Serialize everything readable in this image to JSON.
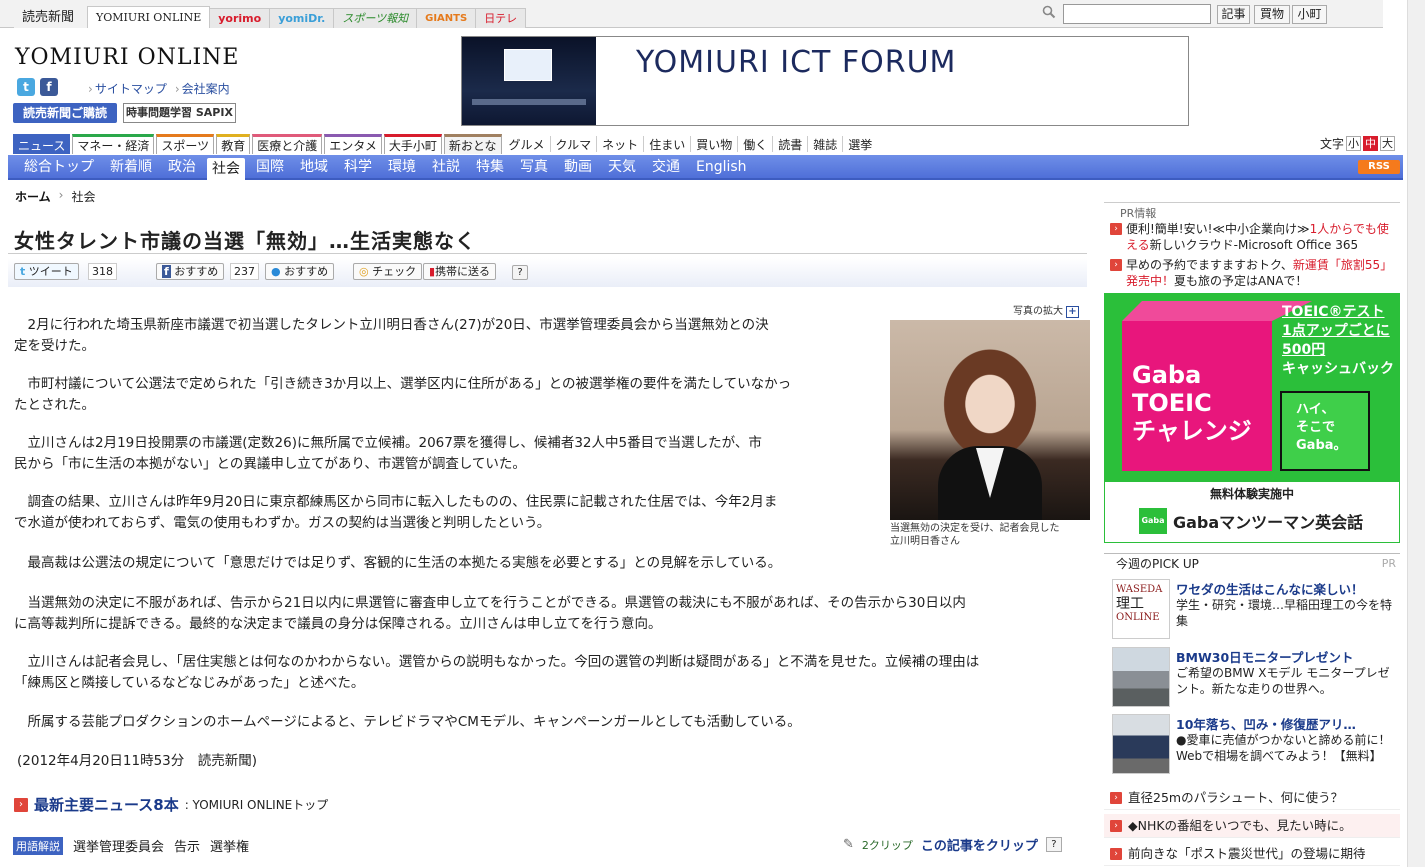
{
  "top_tabs": [
    "読売新聞",
    "YOMIURI ONLINE",
    "yorimo",
    "yomiDr.",
    "スポーツ報知",
    "GIANTS",
    "日テレ"
  ],
  "search": {
    "placeholder": "",
    "buttons": [
      "記事",
      "買物",
      "小町"
    ]
  },
  "header": {
    "logo": "YOMIURI ONLINE",
    "links": [
      "サイトマップ",
      "会社案内"
    ],
    "subscribe": "読売新聞ご購読",
    "sapix": "時事問題学習 SAPIX"
  },
  "banner": {
    "text": "YOMIURI ICT FORUM"
  },
  "category_tabs": [
    "ニュース",
    "マネー・経済",
    "スポーツ",
    "教育",
    "医療と介護",
    "エンタメ",
    "大手小町",
    "新おとな"
  ],
  "category_links": [
    "グルメ",
    "クルマ",
    "ネット",
    "住まい",
    "買い物",
    "働く",
    "読書",
    "雑誌",
    "選挙"
  ],
  "text_size": {
    "label": "文字",
    "options": [
      "小",
      "中",
      "大"
    ]
  },
  "nav": [
    "総合トップ",
    "新着順",
    "政治",
    "社会",
    "国際",
    "地域",
    "科学",
    "環境",
    "社説",
    "特集",
    "写真",
    "動画",
    "天気",
    "交通",
    "English"
  ],
  "nav_active": "社会",
  "rss": "RSS",
  "breadcrumb": {
    "home": "ホーム",
    "current": "社会"
  },
  "article": {
    "headline": "女性タレント市議の当選「無効」…生活実態なく",
    "share": {
      "tweet": "ツイート",
      "tweet_count": "318",
      "fb": "おすすめ",
      "fb_count": "237",
      "mixi": "おすすめ",
      "check": "チェック",
      "mobile": "携帯に送る",
      "help": "?"
    },
    "photo_zoom": "写真の拡大",
    "photo_caption_1": "当選無効の決定を受け、記者会見した",
    "photo_caption_2": "立川明日香さん",
    "paragraphs": [
      [
        "　2月に行われた埼玉県新座市議選で初当選したタレント立川明日香さん(27)が20日、市選挙管理委員会から当選無効との決",
        "定を受けた。"
      ],
      [
        "　市町村議について公選法で定められた「引き続き3か月以上、選挙区内に住所がある」との被選挙権の要件を満たしていなかっ",
        "たとされた。"
      ],
      [
        "　立川さんは2月19日投開票の市議選(定数26)に無所属で立候補。2067票を獲得し、候補者32人中5番目で当選したが、市",
        "民から「市に生活の本拠がない」との異議申し立てがあり、市選管が調査していた。"
      ],
      [
        "　調査の結果、立川さんは昨年9月20日に東京都練馬区から同市に転入したものの、住民票に記載された住居では、今年2月ま",
        "で水道が使われておらず、電気の使用もわずか。ガスの契約は当選後と判明したという。"
      ],
      [
        "　最高裁は公選法の規定について「意思だけでは足りず、客観的に生活の本拠たる実態を必要とする」との見解を示している。"
      ],
      [
        "　当選無効の決定に不服があれば、告示から21日以内に県選管に審査申し立てを行うことができる。県選管の裁決にも不服があれば、その告示から30日以内",
        "に高等裁判所に提訴できる。最終的な決定まで議員の身分は保障される。立川さんは申し立てを行う意向。"
      ],
      [
        "　立川さんは記者会見し、「居住実態とは何なのかわからない。選管からの説明もなかった。今回の選管の判断は疑問がある」と不満を見せた。立候補の理由は",
        "「練馬区と隣接しているなどなじみがあった」と述べた。"
      ],
      [
        "　所属する芸能プロダクションのホームページによると、テレビドラマやCMモデル、キャンペーンガールとしても活動している。"
      ]
    ],
    "date": "(2012年4月20日11時53分　読売新聞)",
    "more_news": "最新主要ニュース8本",
    "more_news_sub": ": YOMIURI ONLINEトップ",
    "glossary_label": "用語解説",
    "glossary": [
      "選挙管理委員会",
      "告示",
      "選挙権"
    ],
    "clip_count": "2クリップ",
    "clip_label": "この記事をクリップ"
  },
  "pr": {
    "label": "PR情報",
    "items": [
      {
        "pre": "便利!簡単!安い!≪中小企業向け≫",
        "red": "1人からでも使える",
        "post": "新しいクラウド-Microsoft Office 365"
      },
      {
        "pre": "早めの予約でますますおトク、",
        "red": "新運賃「旅割55」発売中！",
        "post": "夏も旅の予定はANAで！"
      }
    ]
  },
  "ad": {
    "toeic_1": "TOEIC®テスト",
    "toeic_2": "1点アップごとに",
    "toeic_3": "500円",
    "toeic_4": "キャッシュバック",
    "cube_1": "Gaba",
    "cube_2": "TOEIC",
    "cube_3": "チャレンジ",
    "side_1": "ハイ、",
    "side_2": "そこで",
    "side_3": "Gaba。",
    "free": "無料体験実施中",
    "brand": "Gabaマンツーマン英会話",
    "brand_small": "Gaba"
  },
  "pickup": {
    "title": "今週のPICK UP",
    "pr": "PR",
    "items": [
      {
        "title": "ワセダの生活はこんなに楽しい！",
        "desc": "学生・研究・環境…早稲田理工の今を特集"
      },
      {
        "title": "BMW30日モニタープレゼント",
        "desc": "ご希望のBMW Xモデル モニタープレゼント。新たな走りの世界へ。"
      },
      {
        "title": "10年落ち、凹み・修復歴アリ…",
        "desc": "●愛車に売値がつかないと諦める前に！Webで相場を調べてみよう！【無料】"
      }
    ]
  },
  "right_links": [
    "直径25mのパラシュート、何に使う？",
    "◆NHKの番組をいつでも、見たい時に。",
    "前向きな「ポスト震災世代」の登場に期待"
  ],
  "waseda_logo": [
    "WASEDA",
    "理工",
    "ONLINE"
  ]
}
